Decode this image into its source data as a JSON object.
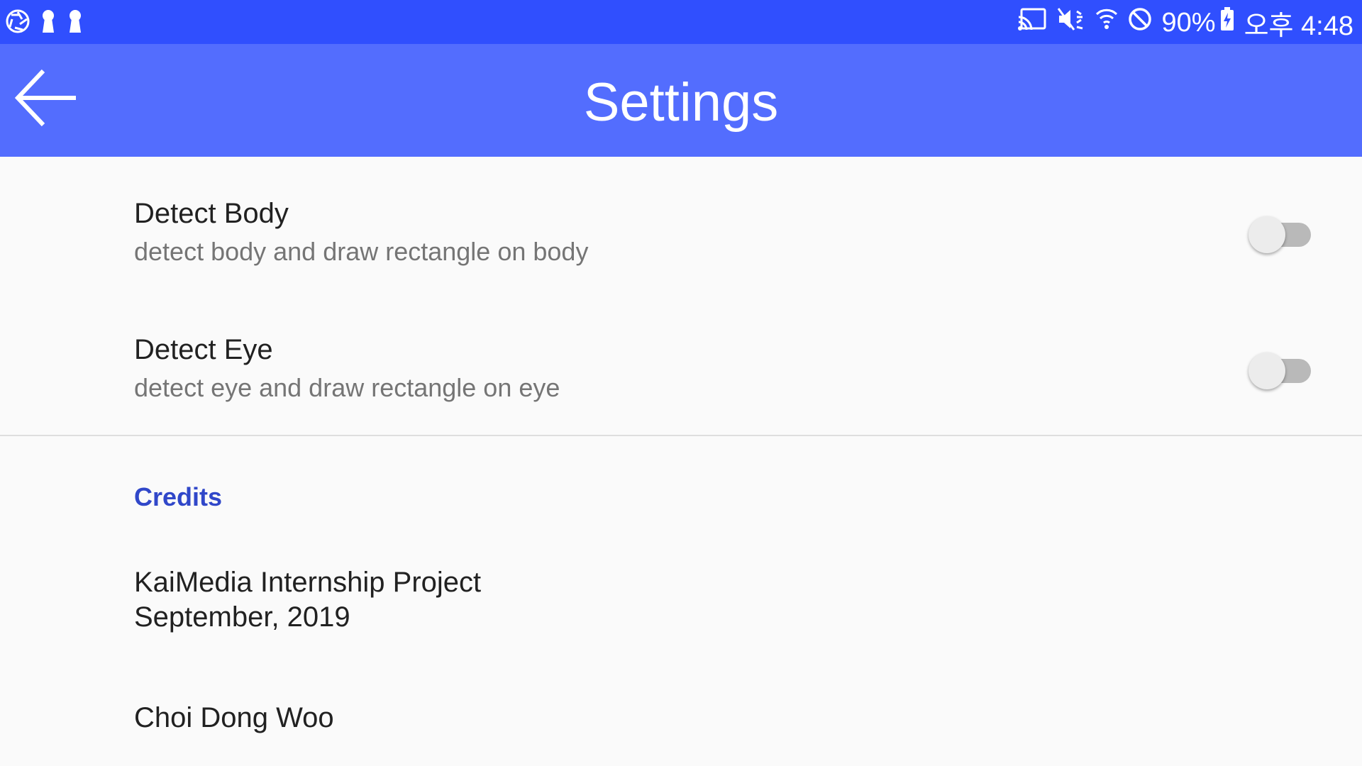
{
  "status_bar": {
    "icons_left": [
      "camera-shutter-icon",
      "keyhole-icon",
      "keyhole-icon"
    ],
    "icons_right": [
      "cast-icon",
      "mute-icon",
      "wifi-icon",
      "do-not-disturb-icon"
    ],
    "battery_percent": "90%",
    "battery_icon": "battery-charging-icon",
    "time": "오후 4:48"
  },
  "app_bar": {
    "title": "Settings",
    "back_icon": "arrow-back-icon",
    "background": "#536dfe",
    "status_background": "#304ffe"
  },
  "preferences": [
    {
      "title": "Detect Body",
      "summary": "detect body and draw rectangle on body",
      "enabled": false
    },
    {
      "title": "Detect Eye",
      "summary": "detect eye and draw rectangle on eye",
      "enabled": false
    }
  ],
  "credits": {
    "category": "Credits",
    "category_color": "#3047c9",
    "project_line1": "KaiMedia Internship Project",
    "project_line2": "September, 2019",
    "author": "Choi Dong Woo"
  }
}
